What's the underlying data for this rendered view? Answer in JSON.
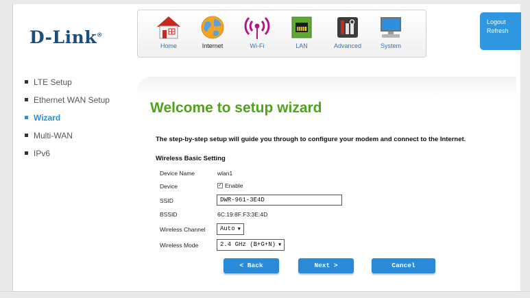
{
  "brand": {
    "logo": "D-Link",
    "mark": "®"
  },
  "nav": {
    "items": [
      {
        "label": "Home",
        "icon": "home-icon"
      },
      {
        "label": "Internet",
        "icon": "globe-icon"
      },
      {
        "label": "Wi-Fi",
        "icon": "wifi-icon"
      },
      {
        "label": "LAN",
        "icon": "lan-icon"
      },
      {
        "label": "Advanced",
        "icon": "tools-icon"
      },
      {
        "label": "System",
        "icon": "computer-icon"
      }
    ],
    "active": "Internet"
  },
  "top_links": {
    "logout": "Logout",
    "refresh": "Refresh"
  },
  "sidebar": {
    "items": [
      {
        "label": "LTE Setup"
      },
      {
        "label": "Ethernet WAN Setup"
      },
      {
        "label": "Wizard"
      },
      {
        "label": "Multi-WAN"
      },
      {
        "label": "IPv6"
      }
    ],
    "active": "Wizard"
  },
  "main": {
    "title": "Welcome to setup wizard",
    "intro": "The step-by-step setup will guide you through to configure your modem and connect to the Internet.",
    "section_title": "Wireless Basic Setting",
    "fields": {
      "device_name": {
        "label": "Device Name",
        "value": "wlan1"
      },
      "device": {
        "label": "Device",
        "checkbox_label": "Enable",
        "checked": true
      },
      "ssid": {
        "label": "SSID",
        "value": "DWR-961-3E4D"
      },
      "bssid": {
        "label": "BSSID",
        "value": "6C:19:8F:F3:3E:4D"
      },
      "channel": {
        "label": "Wireless Channel",
        "value": "Auto"
      },
      "mode": {
        "label": "Wireless Mode",
        "value": "2.4 GHz (B+G+N)"
      }
    },
    "buttons": {
      "back": "< Back",
      "next": "Next >",
      "cancel": "Cancel"
    }
  },
  "colors": {
    "accent_blue": "#2a8ad8",
    "title_green": "#4ea31a",
    "brand_navy": "#1d4e77"
  }
}
